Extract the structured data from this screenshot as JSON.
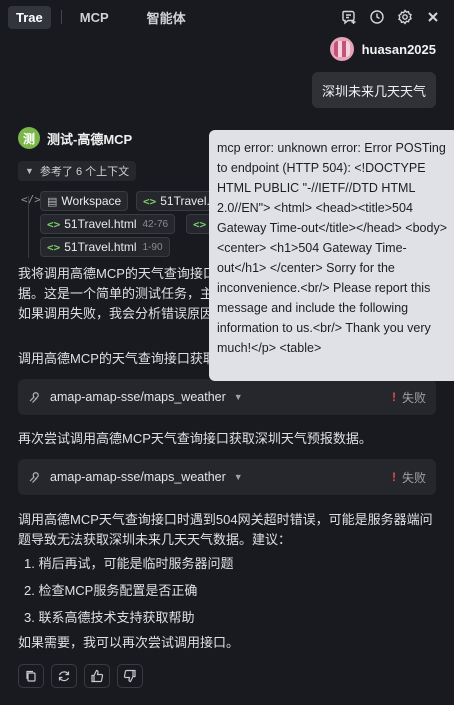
{
  "tabs": [
    {
      "label": "Trae",
      "active": true
    },
    {
      "label": "MCP",
      "active": false
    },
    {
      "label": "智能体",
      "active": false
    }
  ],
  "top_icons": [
    "new-chat-icon",
    "history-icon",
    "settings-icon",
    "close-icon"
  ],
  "user": {
    "name": "huasan2025",
    "message": "深圳未来几天天气"
  },
  "agent": {
    "avatar_text": "测",
    "name": "测试-高德MCP"
  },
  "references": {
    "label": "参考了 6 个上下文",
    "chips": [
      {
        "icon": "folder-icon",
        "name": "Workspace",
        "range": ""
      },
      {
        "icon": "code-icon",
        "name": "51Travel.",
        "range": ""
      },
      {
        "icon": "code-icon",
        "name": "51Travel.html",
        "range": "42-76"
      },
      {
        "icon": "code-icon",
        "name": "5",
        "range": ""
      },
      {
        "icon": "code-icon",
        "name": "51Travel.html",
        "range": "1-90"
      }
    ]
  },
  "paragraphs": {
    "p1_line1": "我将调用高德MCP的天气查询接口",
    "p1_line2": "据。这是一个简单的测试任务，主",
    "p1_line3": "如果调用失败，我会分析错误原因",
    "p2": "调用高德MCP的天气查询接口获取",
    "p3": "再次尝试调用高德MCP天气查询接口获取深圳天气预报数据。",
    "p4_line1": "调用高德MCP天气查询接口时遇到504网关超时错误，可能是服务器端问",
    "p4_line2": "题导致无法获取深圳未来几天天气数据。建议：",
    "p5": "如果需要，我可以再次尝试调用接口。"
  },
  "tool_calls": [
    {
      "name": "amap-amap-sse/maps_weather",
      "status": "失败"
    },
    {
      "name": "amap-amap-sse/maps_weather",
      "status": "失败"
    }
  ],
  "suggestions": [
    "1. 稍后再试，可能是临时服务器问题",
    "2. 检查MCP服务配置是否正确",
    "3. 联系高德技术支持获取帮助"
  ],
  "tooltip": {
    "text": "mcp error: unknown error: Error POSTing to endpoint (HTTP 504): <!DOCTYPE HTML PUBLIC \"-//IETF//DTD HTML 2.0//EN\"> <html> <head><title>504 Gateway Time-out</title></head> <body> <center> <h1>504 Gateway Time-out</h1> </center> Sorry for the inconvenience.<br/> Please report this message and include the following information to us.<br/> Thank you very much!</p> <table>"
  },
  "message_actions": [
    "copy-icon",
    "regenerate-icon",
    "thumbs-up-icon",
    "thumbs-down-icon"
  ],
  "colors": {
    "background": "#191a1f",
    "success_green": "#7ccf6c",
    "error_red": "#e5484d",
    "agent_avatar": "#7bb649"
  }
}
